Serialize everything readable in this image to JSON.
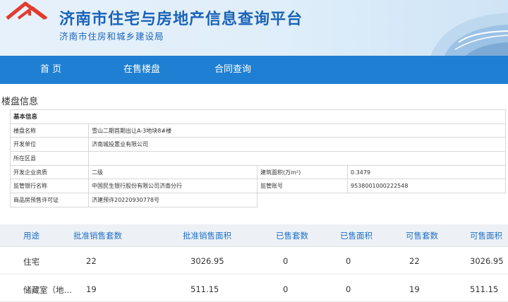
{
  "header": {
    "title": "济南市住宅与房地产信息查询平台",
    "subtitle": "济南市住房和城乡建设局"
  },
  "nav": [
    "首  页",
    "在售楼盘",
    "合同查询"
  ],
  "section_title": "楼盘信息",
  "basic_info": {
    "heading": "基本信息",
    "project_name_label": "楼盘名称",
    "project_name": "雪山二期首期出让A-3地块8#楼",
    "developer_label": "开发单位",
    "developer": "济南城投置业有限公司",
    "district_label": "所在区县",
    "district": "",
    "qualification_label": "开发企业资质",
    "qualification": "二级",
    "area_label": "建筑面积(万m²)",
    "area": "0.3479",
    "bank_label": "监管银行名称",
    "bank": "中国民生银行股份有限公司济南分行",
    "account_label": "监管账号",
    "account": "9538001000222548",
    "permit_label": "商品房预售许可证",
    "permit": "济建预许20220930778号"
  },
  "sales_table": {
    "columns": [
      "用途",
      "批准销售套数",
      "批准销售面积",
      "已售套数",
      "已售面积",
      "可售套数",
      "可售面积"
    ],
    "rows": [
      [
        "住宅",
        "22",
        "3026.95",
        "0",
        "0",
        "22",
        "3026.95"
      ],
      [
        "储藏室（地…",
        "19",
        "511.15",
        "0",
        "0",
        "19",
        "511.15"
      ]
    ]
  },
  "colors": {
    "brand_blue": "#1a63b8",
    "nav_blue": "#1f7fd2",
    "roof_red": "#e23b2e"
  }
}
